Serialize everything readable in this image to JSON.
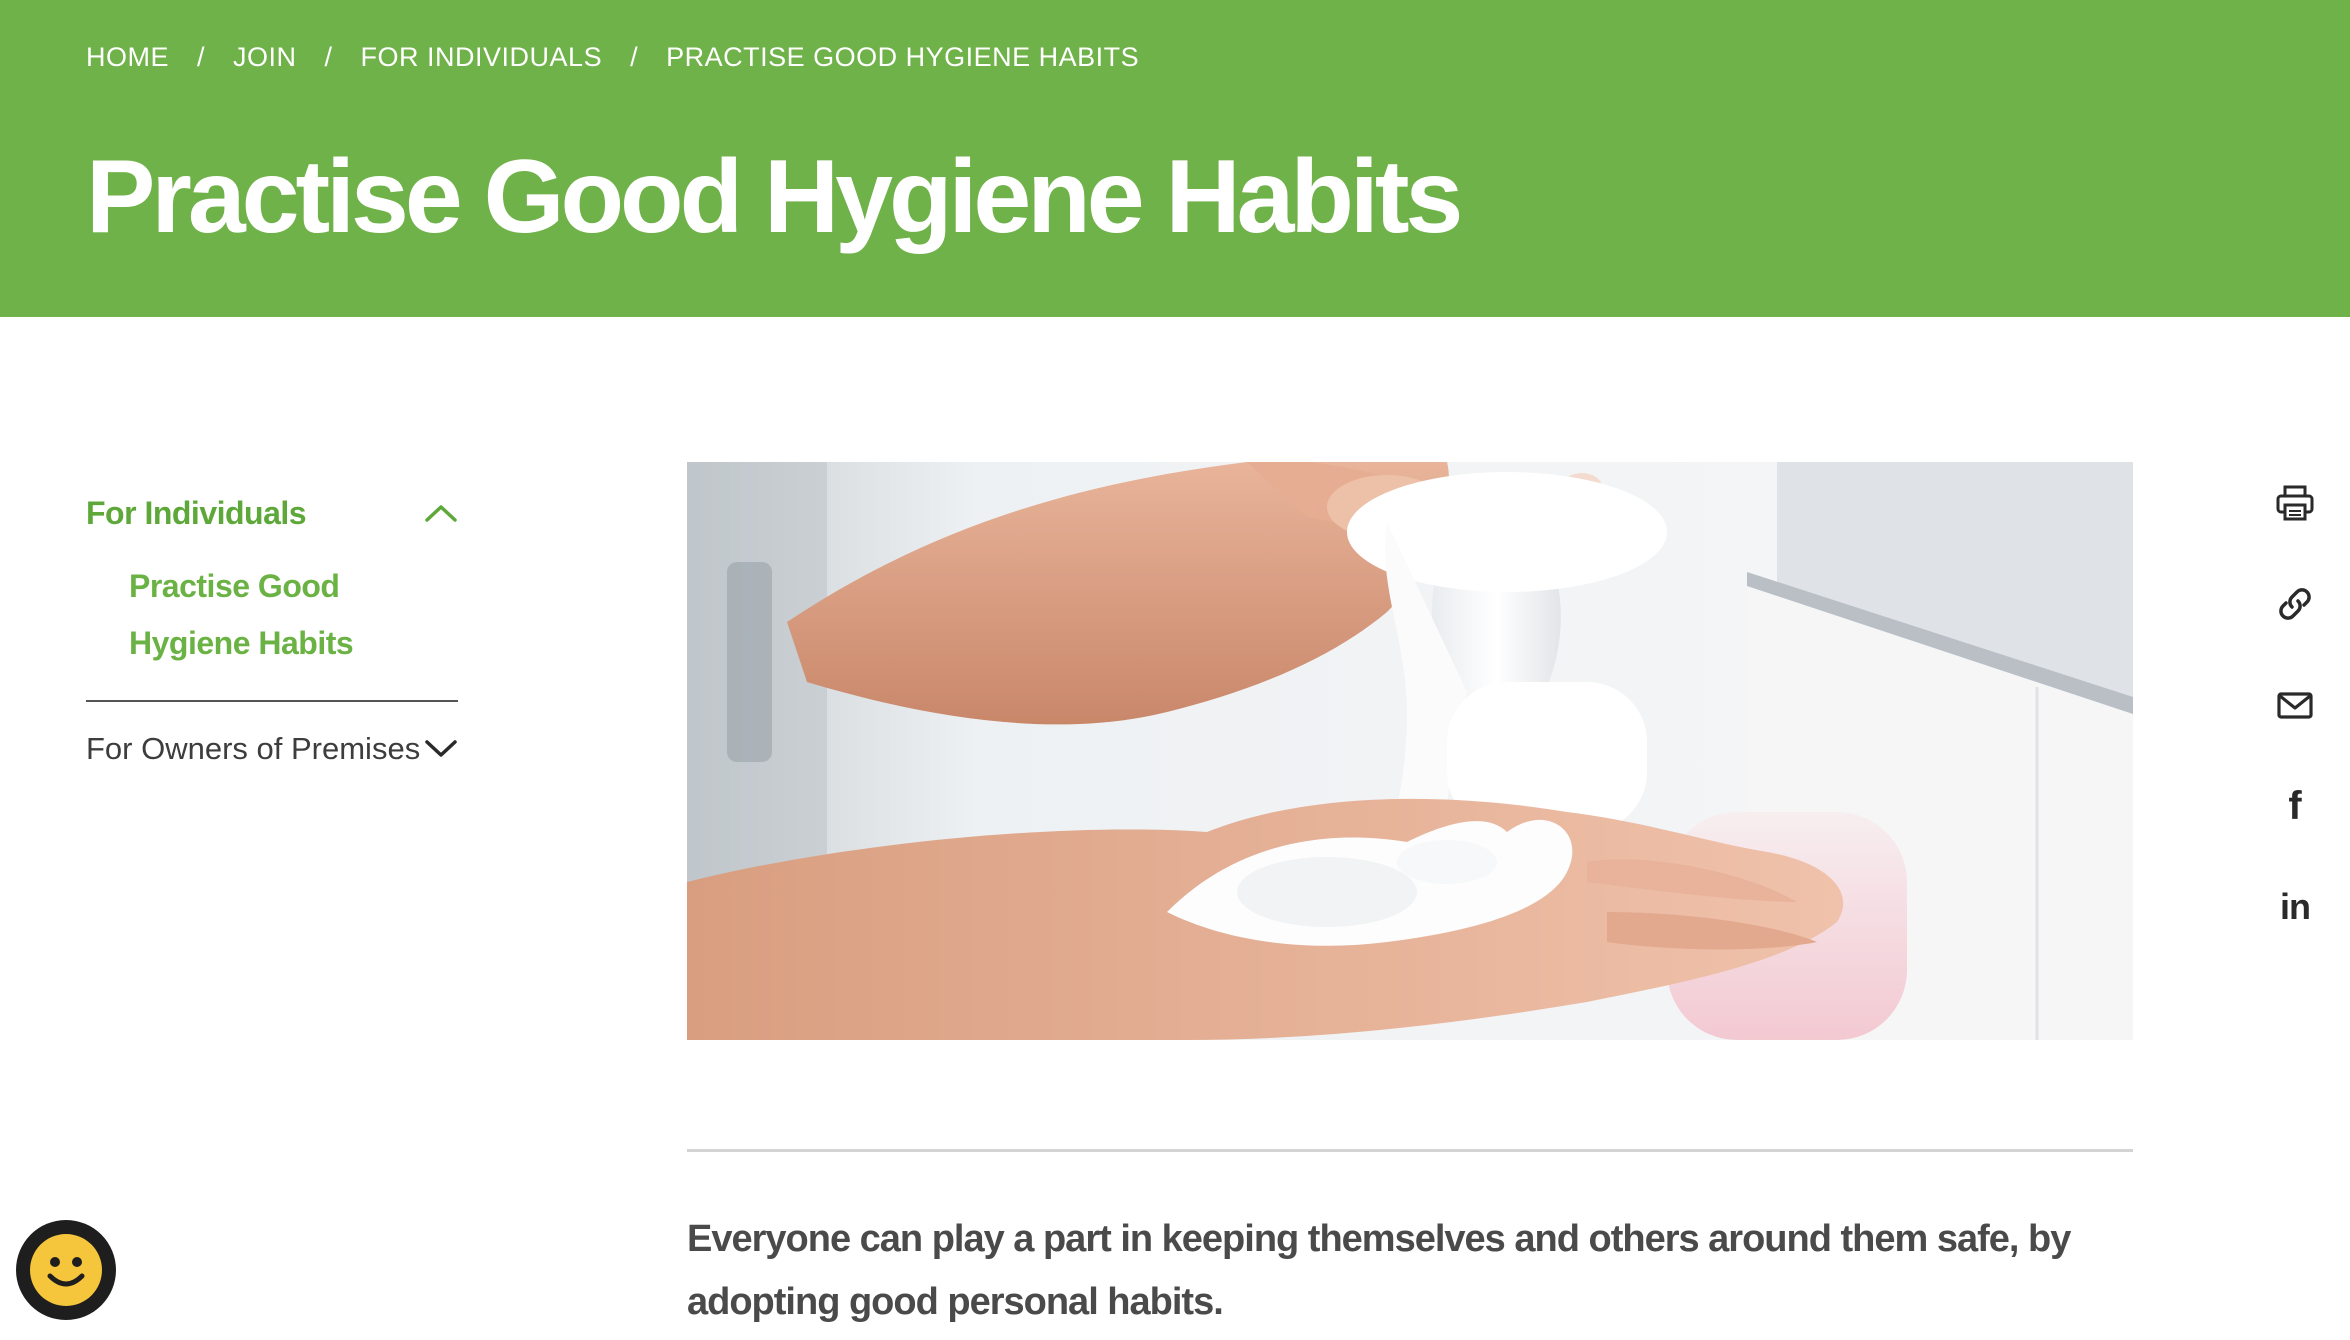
{
  "breadcrumb": {
    "items": [
      "HOME",
      "JOIN",
      "FOR INDIVIDUALS",
      "PRACTISE GOOD HYGIENE HABITS"
    ],
    "separator": "/"
  },
  "page": {
    "title": "Practise Good Hygiene Habits"
  },
  "sidebar": {
    "section_1": {
      "label": "For Individuals",
      "expanded": true,
      "children": [
        "Practise Good Hygiene Habits"
      ]
    },
    "section_2": {
      "label": "For Owners of Premises",
      "expanded": false
    }
  },
  "main": {
    "image_alt": "Hands dispensing foam soap from a pump bottle",
    "lead": "Everyone can play a part in keeping themselves and others around them safe, by adopting good personal habits."
  },
  "share": {
    "icons": [
      "print-icon",
      "link-icon",
      "mail-icon",
      "facebook-icon",
      "linkedin-icon"
    ]
  },
  "colors": {
    "brand_green": "#70b24a",
    "nav_green": "#5ea83a",
    "text_dark": "#484848",
    "feedback_yellow": "#f5c63b"
  }
}
